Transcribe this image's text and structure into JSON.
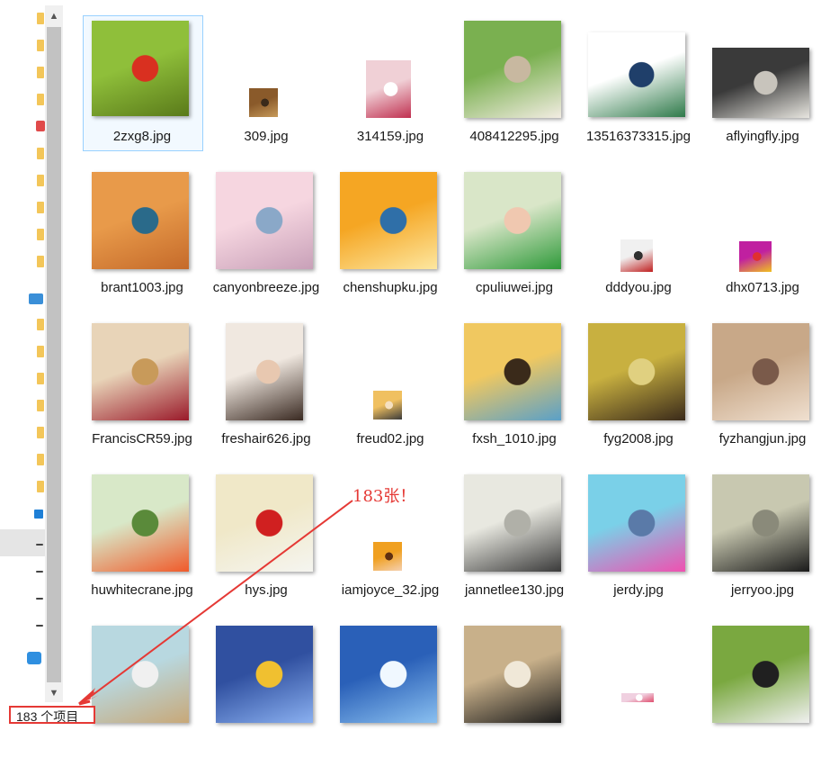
{
  "files": [
    {
      "name": "2zxg8.jpg",
      "selected": true,
      "colors": [
        "#8fbf3a",
        "#5a7a1a",
        "#d93020"
      ]
    },
    {
      "name": "309.jpg",
      "colors": [
        "#8a5a2a",
        "#c79a5a",
        "#3a2a1a"
      ]
    },
    {
      "name": "314159.jpg",
      "colors": [
        "#f0d0d6",
        "#c03050",
        "#ffffff"
      ]
    },
    {
      "name": "408412295.jpg",
      "colors": [
        "#7ab050",
        "#f2ece2",
        "#c8b8a0"
      ]
    },
    {
      "name": "13516373315.jpg",
      "colors": [
        "#ffffff",
        "#2f7a4a",
        "#1f3f6a"
      ]
    },
    {
      "name": "aflyingfly.jpg",
      "colors": [
        "#3a3a3a",
        "#e8e6e0",
        "#c8c4bc"
      ]
    },
    {
      "name": "brant1003.jpg",
      "colors": [
        "#e89a4a",
        "#c56a2a",
        "#2a6a8a"
      ]
    },
    {
      "name": "canyonbreeze.jpg",
      "colors": [
        "#f6d6e0",
        "#c8a0b8",
        "#8aa8c8"
      ]
    },
    {
      "name": "chenshupku.jpg",
      "colors": [
        "#f5a623",
        "#fde7a0",
        "#2f6fa8"
      ]
    },
    {
      "name": "cpuliuwei.jpg",
      "colors": [
        "#d9e6c8",
        "#2f9a3a",
        "#f0c8b0"
      ]
    },
    {
      "name": "dddyou.jpg",
      "colors": [
        "#f0f0f0",
        "#c02020",
        "#303030"
      ]
    },
    {
      "name": "dhx0713.jpg",
      "colors": [
        "#c020a0",
        "#f0c020",
        "#e03030"
      ]
    },
    {
      "name": "FrancisCR59.jpg",
      "colors": [
        "#e8d4b8",
        "#9a1a2a",
        "#c89a5a"
      ]
    },
    {
      "name": "freshair626.jpg",
      "colors": [
        "#f0e8e0",
        "#3a2a22",
        "#e8c8b0"
      ]
    },
    {
      "name": "freud02.jpg",
      "colors": [
        "#f0c060",
        "#3a3a3a",
        "#f5e0c0"
      ]
    },
    {
      "name": "fxsh_1010.jpg",
      "colors": [
        "#f0c860",
        "#5aa0c8",
        "#3a2a1a"
      ]
    },
    {
      "name": "fyg2008.jpg",
      "colors": [
        "#c8b040",
        "#3a2a1a",
        "#e0d080"
      ]
    },
    {
      "name": "fyzhangjun.jpg",
      "colors": [
        "#c8a888",
        "#f0e0d0",
        "#7a5a4a"
      ]
    },
    {
      "name": "huwhitecrane.jpg",
      "colors": [
        "#d8e8c8",
        "#f05a2a",
        "#5a8a3a"
      ]
    },
    {
      "name": "hys.jpg",
      "colors": [
        "#f0e8c8",
        "#f5f5f0",
        "#d02020"
      ]
    },
    {
      "name": "iamjoyce_32.jpg",
      "colors": [
        "#f0a020",
        "#f5d0b0",
        "#603010"
      ]
    },
    {
      "name": "jannetlee130.jpg",
      "colors": [
        "#e8e8e0",
        "#3a3a3a",
        "#b0b0a8"
      ]
    },
    {
      "name": "jerdy.jpg",
      "colors": [
        "#7ad0e8",
        "#f050b0",
        "#5a7aa8"
      ]
    },
    {
      "name": "jerryoo.jpg",
      "colors": [
        "#c8c8b0",
        "#1a1a1a",
        "#8a8a7a"
      ]
    },
    {
      "name": "",
      "colors": [
        "#b8d8e0",
        "#c8a878",
        "#f0f0f0"
      ]
    },
    {
      "name": "",
      "colors": [
        "#3050a0",
        "#8ab0f0",
        "#f0c030"
      ]
    },
    {
      "name": "",
      "colors": [
        "#2a60b8",
        "#8ac0f0",
        "#f0f8ff"
      ]
    },
    {
      "name": "",
      "colors": [
        "#c8b08a",
        "#1a1a1a",
        "#f0e8d8"
      ]
    },
    {
      "name": "",
      "colors": [
        "#f0d0e0",
        "#e05070",
        "#ffffff"
      ]
    },
    {
      "name": "",
      "colors": [
        "#7aa840",
        "#f0f0f0",
        "#202020"
      ]
    }
  ],
  "annotation": {
    "text": "183张！"
  },
  "status": {
    "item_count": "183 个项目"
  },
  "scroll": {
    "up": "▲",
    "down": "▼"
  }
}
